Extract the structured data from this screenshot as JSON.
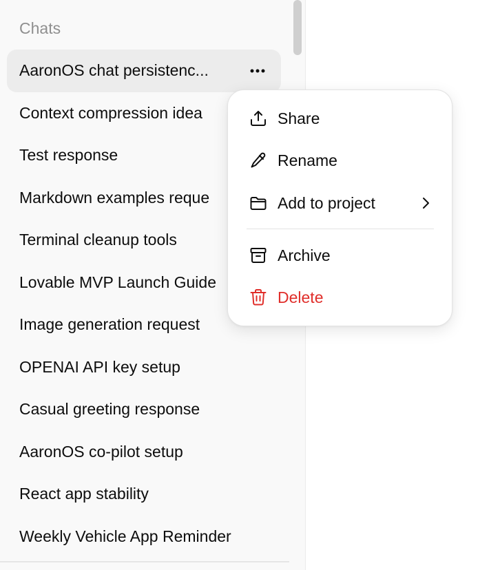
{
  "sidebar": {
    "section_label": "Chats",
    "active_index": 0,
    "chats": [
      "AaronOS chat persistenc...",
      "Context compression idea",
      "Test response",
      "Markdown examples reque",
      "Terminal cleanup tools",
      "Lovable MVP Launch Guide",
      "Image generation request",
      "OPENAI API key setup",
      "Casual greeting response",
      "AaronOS co-pilot setup",
      "React app stability",
      "Weekly Vehicle App Reminder"
    ]
  },
  "context_menu": {
    "share_label": "Share",
    "rename_label": "Rename",
    "add_to_project_label": "Add to project",
    "archive_label": "Archive",
    "delete_label": "Delete"
  },
  "colors": {
    "sidebar_bg": "#f9f9f9",
    "active_bg": "#ececec",
    "text": "#0d0d0d",
    "muted_text": "#8f8f8f",
    "danger": "#e02e2a",
    "menu_bg": "#ffffff"
  },
  "icons": {
    "more": "ellipsis-icon",
    "share": "share-upload-icon",
    "rename": "pencil-icon",
    "add_to_project": "folder-icon",
    "submenu": "chevron-right-icon",
    "archive": "archive-box-icon",
    "delete": "trash-icon"
  }
}
